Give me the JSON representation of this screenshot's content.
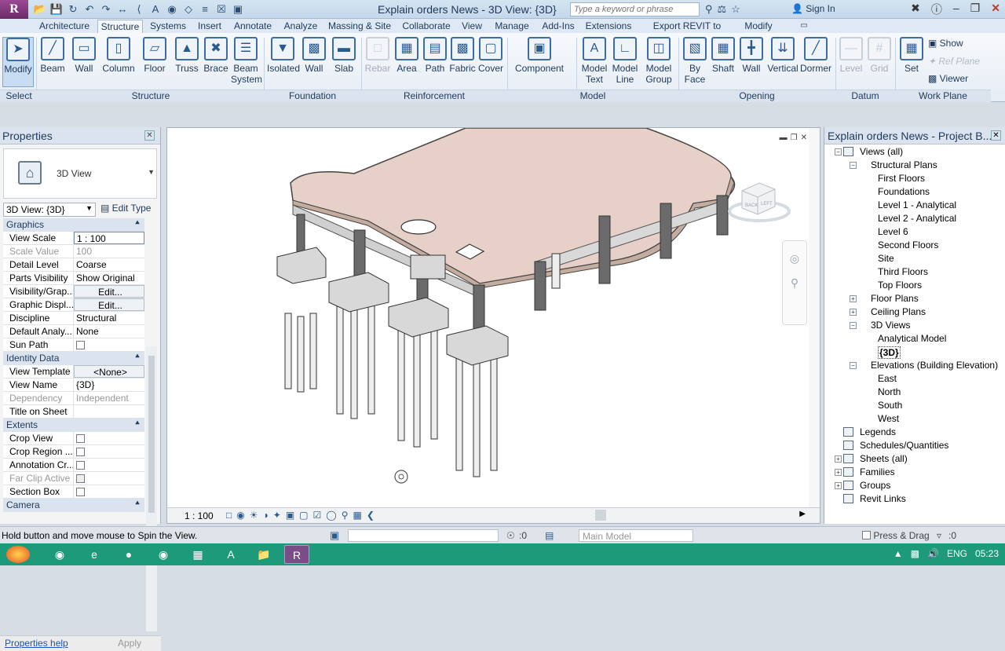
{
  "titlebar": {
    "app_initial": "R",
    "title": "Explain orders News - 3D View: {3D}",
    "search_placeholder": "Type a keyword or phrase",
    "sign_in": "Sign In",
    "qat_icons": [
      "open-icon",
      "save-icon",
      "sync-icon",
      "undo-icon",
      "redo-icon",
      "measure-icon",
      "dimension-icon",
      "text-icon",
      "3d-view-icon",
      "section-icon",
      "thin-lines-icon",
      "close-hidden-icon",
      "switch-windows-icon"
    ]
  },
  "tabs": [
    "Architecture",
    "Structure",
    "Systems",
    "Insert",
    "Annotate",
    "Analyze",
    "Massing & Site",
    "Collaborate",
    "View",
    "Manage",
    "Add-Ins",
    "Extensions",
    "Export REVIT to ETABS",
    "Modify"
  ],
  "active_tab": "Structure",
  "ribbon": {
    "buttons": {
      "modify": "Modify",
      "beam": "Beam",
      "wall": "Wall",
      "column": "Column",
      "floor": "Floor",
      "truss": "Truss",
      "brace": "Brace",
      "beam_system": "Beam System",
      "isolated": "Isolated",
      "wall_found": "Wall",
      "slab": "Slab",
      "rebar": "Rebar",
      "area": "Area",
      "path": "Path",
      "fabric": "Fabric",
      "cover": "Cover",
      "component": "Component",
      "model_text": "Model Text",
      "model_line": "Model Line",
      "model_group": "Model Group",
      "by_face": "By Face",
      "shaft": "Shaft",
      "wall_opening": "Wall",
      "vertical": "Vertical",
      "dormer": "Dormer",
      "level": "Level",
      "grid": "Grid",
      "set": "Set",
      "show": "Show",
      "ref_plane": "Ref Plane",
      "viewer": "Viewer"
    },
    "panels": {
      "select": "Select",
      "structure": "Structure",
      "foundation": "Foundation",
      "reinforcement": "Reinforcement",
      "model": "Model",
      "opening": "Opening",
      "datum": "Datum",
      "work_plane": "Work Plane"
    }
  },
  "properties": {
    "title": "Properties",
    "type_name": "3D View",
    "instance": "3D View: {3D}",
    "edit_type": "Edit Type",
    "groups": [
      {
        "name": "Graphics",
        "rows": [
          {
            "name": "View Scale",
            "value": "1 : 100",
            "kind": "input"
          },
          {
            "name": "Scale Value",
            "value": "100",
            "kind": "disabled"
          },
          {
            "name": "Detail Level",
            "value": "Coarse",
            "kind": "text"
          },
          {
            "name": "Parts Visibility",
            "value": "Show Original",
            "kind": "text"
          },
          {
            "name": "Visibility/Grap...",
            "value": "Edit...",
            "kind": "button"
          },
          {
            "name": "Graphic Displ...",
            "value": "Edit...",
            "kind": "button"
          },
          {
            "name": "Discipline",
            "value": "Structural",
            "kind": "text"
          },
          {
            "name": "Default Analy...",
            "value": "None",
            "kind": "text"
          },
          {
            "name": "Sun Path",
            "value": "",
            "kind": "check"
          }
        ]
      },
      {
        "name": "Identity Data",
        "rows": [
          {
            "name": "View Template",
            "value": "<None>",
            "kind": "button"
          },
          {
            "name": "View Name",
            "value": "{3D}",
            "kind": "text"
          },
          {
            "name": "Dependency",
            "value": "Independent",
            "kind": "disabled"
          },
          {
            "name": "Title on Sheet",
            "value": "",
            "kind": "text"
          }
        ]
      },
      {
        "name": "Extents",
        "rows": [
          {
            "name": "Crop View",
            "value": "",
            "kind": "check"
          },
          {
            "name": "Crop Region ...",
            "value": "",
            "kind": "check"
          },
          {
            "name": "Annotation Cr...",
            "value": "",
            "kind": "check"
          },
          {
            "name": "Far Clip Active",
            "value": "",
            "kind": "check-disabled"
          },
          {
            "name": "Section Box",
            "value": "",
            "kind": "check"
          }
        ]
      },
      {
        "name": "Camera",
        "rows": []
      }
    ],
    "help": "Properties help",
    "apply": "Apply"
  },
  "viewport": {
    "scale": "1 : 100",
    "viewcube_faces": [
      "BACK",
      "LEFT"
    ]
  },
  "browser": {
    "title": "Explain orders News - Project B...",
    "items": [
      {
        "label": "Views (all)",
        "level": 0,
        "exp": "-",
        "icon": true
      },
      {
        "label": "Structural Plans",
        "level": 1,
        "exp": "-"
      },
      {
        "label": "First Floors",
        "level": 2
      },
      {
        "label": "Foundations",
        "level": 2
      },
      {
        "label": "Level 1 - Analytical",
        "level": 2
      },
      {
        "label": "Level 2 - Analytical",
        "level": 2
      },
      {
        "label": "Level 6",
        "level": 2
      },
      {
        "label": "Second Floors",
        "level": 2
      },
      {
        "label": "Site",
        "level": 2
      },
      {
        "label": "Third Floors",
        "level": 2
      },
      {
        "label": "Top Floors",
        "level": 2
      },
      {
        "label": "Floor Plans",
        "level": 1,
        "exp": "+"
      },
      {
        "label": "Ceiling Plans",
        "level": 1,
        "exp": "+"
      },
      {
        "label": "3D Views",
        "level": 1,
        "exp": "-"
      },
      {
        "label": "Analytical Model",
        "level": 2
      },
      {
        "label": "{3D}",
        "level": 2,
        "selected": true
      },
      {
        "label": "Elevations (Building Elevation)",
        "level": 1,
        "exp": "-"
      },
      {
        "label": "East",
        "level": 2
      },
      {
        "label": "North",
        "level": 2
      },
      {
        "label": "South",
        "level": 2
      },
      {
        "label": "West",
        "level": 2
      },
      {
        "label": "Legends",
        "level": 0,
        "icon": true
      },
      {
        "label": "Schedules/Quantities",
        "level": 0,
        "icon": true
      },
      {
        "label": "Sheets (all)",
        "level": 0,
        "exp": "+",
        "icon": true
      },
      {
        "label": "Families",
        "level": 0,
        "exp": "+",
        "icon": true
      },
      {
        "label": "Groups",
        "level": 0,
        "exp": "+",
        "icon": true
      },
      {
        "label": "Revit Links",
        "level": 0,
        "icon": true
      }
    ]
  },
  "statusbar": {
    "text": "Hold button and move mouse to Spin the View.",
    "selection_count": ":0",
    "workset": "Main Model",
    "press_drag": "Press & Drag",
    "filter_count": ":0"
  },
  "taskbar": {
    "language": "ENG",
    "time": "05:23"
  }
}
